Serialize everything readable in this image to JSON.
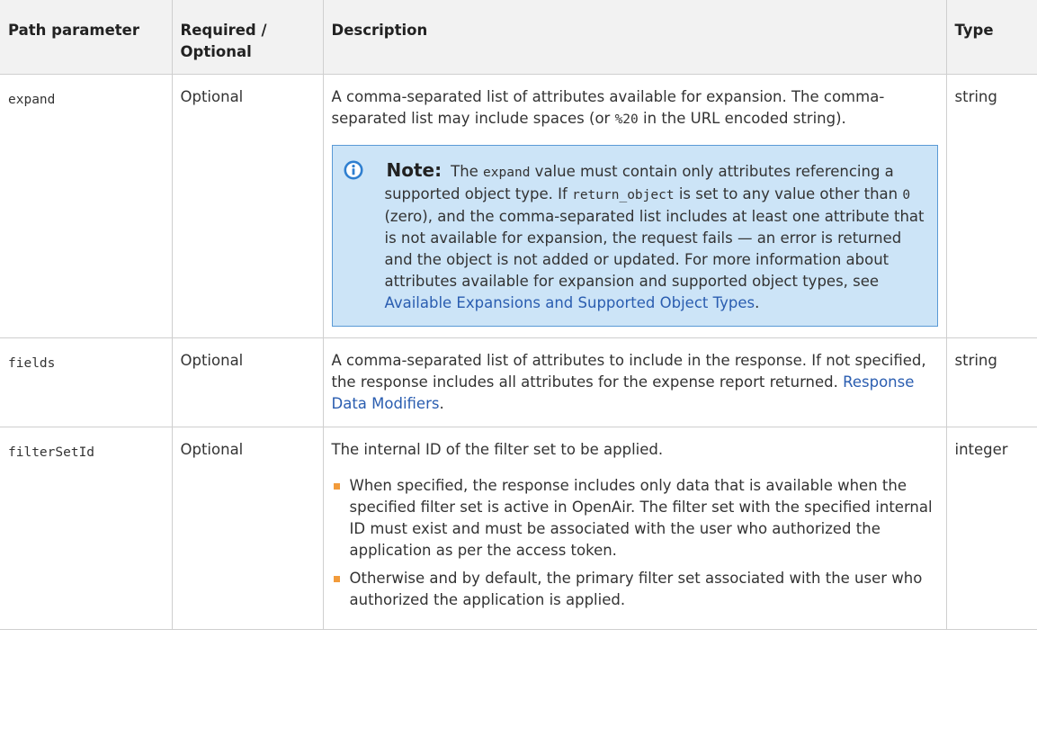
{
  "table": {
    "headers": [
      "Path parameter",
      "Required / Optional",
      "Description",
      "Type"
    ],
    "rows": [
      {
        "name": "expand",
        "required": "Optional",
        "type": "string",
        "description": {
          "p1": "A comma-separated list of attributes available for expansion. The comma-separated list may include spaces (or ",
          "p1_code": "%20",
          "p1_end": " in the URL encoded string).",
          "note": {
            "label": "Note:",
            "t1": "The ",
            "c1": "expand",
            "t2": " value must contain only attributes referencing a supported object type. If ",
            "c2": "return_object",
            "t3": " is set to any value other than ",
            "c3": "0",
            "t4": " (zero), and the comma-separated list includes at least one attribute that is not available for expansion, the request fails — an error is returned and the object is not added or updated. For more information about attributes available for expansion and supported object types, see ",
            "link": "Available Expansions and Supported Object Types",
            "t5": "."
          }
        }
      },
      {
        "name": "fields",
        "required": "Optional",
        "type": "string",
        "description": {
          "text": "A comma-separated list of attributes to include in the response. If not specified, the response includes all attributes for the expense report returned. ",
          "link": "Response Data Modifiers",
          "end": "."
        }
      },
      {
        "name": "filterSetId",
        "required": "Optional",
        "type": "integer",
        "description": {
          "text": "The internal ID of the filter set to be applied.",
          "bullets": [
            "When specified, the response includes only data that is available when the specified filter set is active in OpenAir. The filter set with the specified internal ID must exist and must be associated with the user who authorized the application as per the access token.",
            "Otherwise and by default, the primary filter set associated with the user who authorized the application is applied."
          ]
        }
      }
    ]
  },
  "colors": {
    "note_bg": "#cce4f7",
    "note_border": "#5a9ad6",
    "link": "#2a5db0",
    "bullet": "#f29b3b",
    "header_bg": "#f2f2f2"
  },
  "icons": {
    "note": "info-icon",
    "bullet": "square-bullet"
  }
}
